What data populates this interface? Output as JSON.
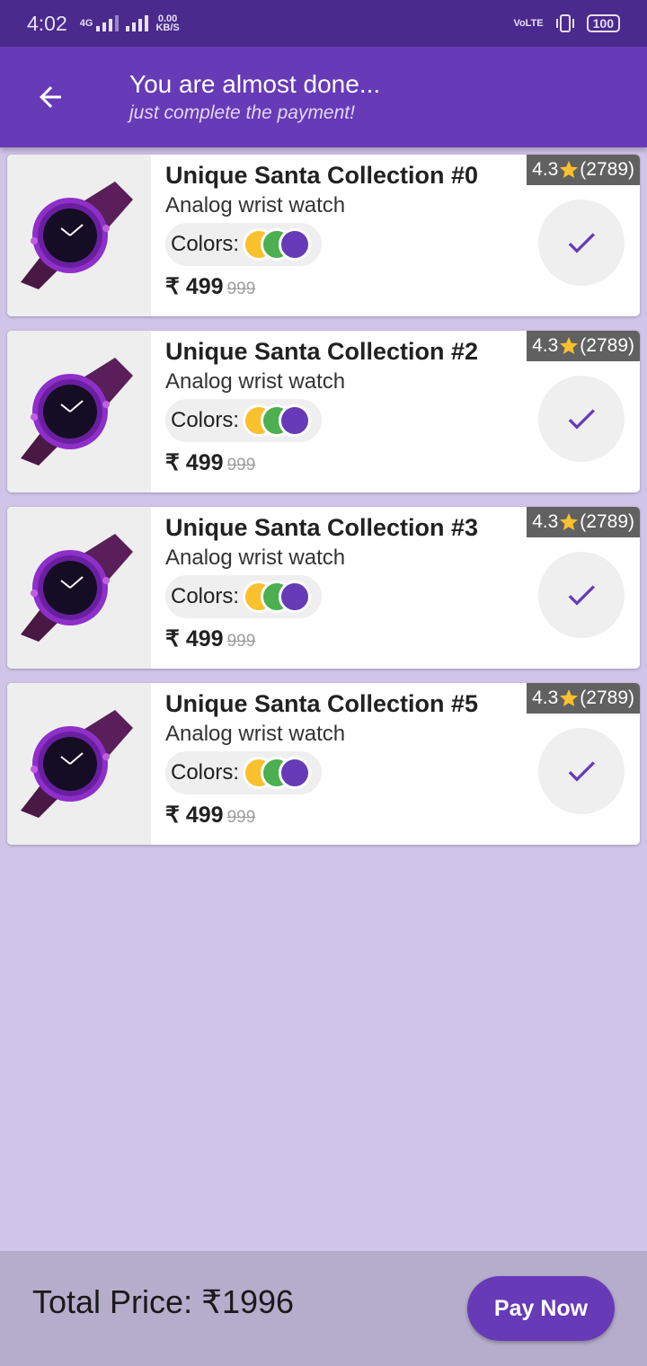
{
  "status_bar": {
    "time": "4:02",
    "network_type": "4G",
    "data_speed": "0.00",
    "data_unit": "KB/S",
    "volte": "VoLTE",
    "battery": "100"
  },
  "app_bar": {
    "back_icon": "arrow-back-icon",
    "title": "You are almost done...",
    "subtitle": "just complete the payment!"
  },
  "colors": {
    "primary": "#673ab7",
    "swatch_1": "#fbc02d",
    "swatch_2": "#4caf50",
    "swatch_3": "#673ab7"
  },
  "products": [
    {
      "name": "Unique Santa Collection #0",
      "desc": "Analog wrist watch",
      "colors_label": "Colors:",
      "price": "₹ 499",
      "old_price": "999",
      "rating": "4.3",
      "reviews": "(2789)"
    },
    {
      "name": "Unique Santa Collection #2",
      "desc": "Analog wrist watch",
      "colors_label": "Colors:",
      "price": "₹ 499",
      "old_price": "999",
      "rating": "4.3",
      "reviews": "(2789)"
    },
    {
      "name": "Unique Santa Collection #3",
      "desc": "Analog wrist watch",
      "colors_label": "Colors:",
      "price": "₹ 499",
      "old_price": "999",
      "rating": "4.3",
      "reviews": "(2789)"
    },
    {
      "name": "Unique Santa Collection #5",
      "desc": "Analog wrist watch",
      "colors_label": "Colors:",
      "price": "₹ 499",
      "old_price": "999",
      "rating": "4.3",
      "reviews": "(2789)"
    }
  ],
  "footer": {
    "total_label": "Total Price: ₹1996",
    "pay_button": "Pay Now"
  }
}
